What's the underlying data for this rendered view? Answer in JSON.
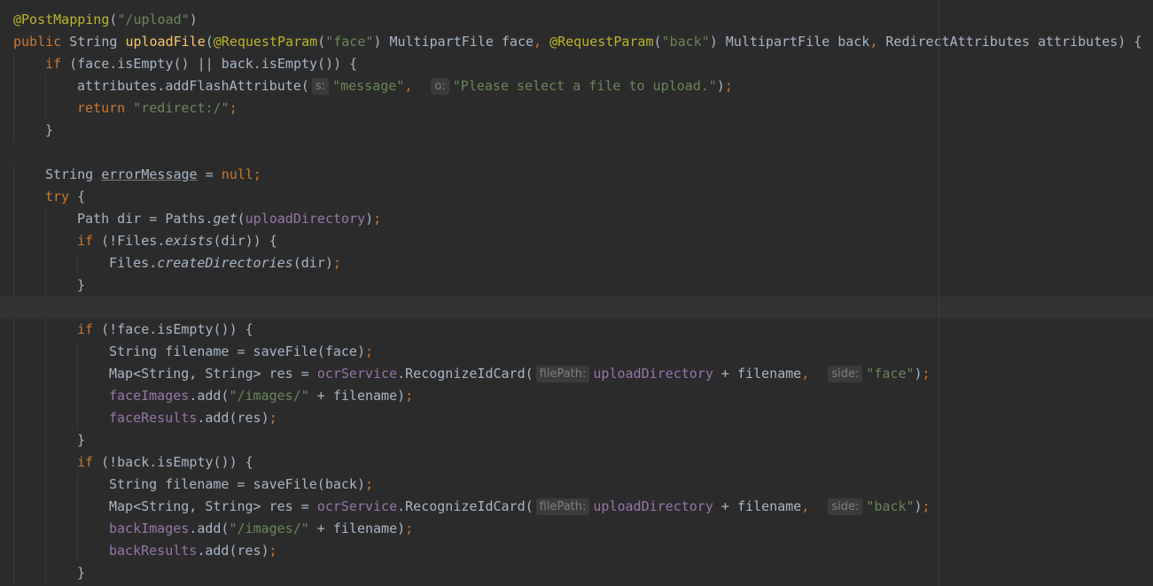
{
  "editor": {
    "language": "Java",
    "theme": "Darcula",
    "lines": [
      {
        "parts": [
          {
            "t": "@PostMapping",
            "c": "ann"
          },
          {
            "t": "(",
            "c": "p"
          },
          {
            "t": "\"/upload\"",
            "c": "str"
          },
          {
            "t": ")",
            "c": "p"
          }
        ]
      },
      {
        "parts": [
          {
            "t": "public ",
            "c": "kw"
          },
          {
            "t": "String ",
            "c": "p"
          },
          {
            "t": "uploadFile",
            "c": "fn"
          },
          {
            "t": "(",
            "c": "p"
          },
          {
            "t": "@RequestParam",
            "c": "ann"
          },
          {
            "t": "(",
            "c": "p"
          },
          {
            "t": "\"face\"",
            "c": "str"
          },
          {
            "t": ") MultipartFile face",
            "c": "p"
          },
          {
            "t": ", ",
            "c": "kw"
          },
          {
            "t": "@RequestParam",
            "c": "ann"
          },
          {
            "t": "(",
            "c": "p"
          },
          {
            "t": "\"back\"",
            "c": "str"
          },
          {
            "t": ") MultipartFile back",
            "c": "p"
          },
          {
            "t": ", ",
            "c": "kw"
          },
          {
            "t": "RedirectAttributes attributes) {",
            "c": "p"
          }
        ]
      },
      {
        "indent": 1,
        "parts": [
          {
            "t": "if ",
            "c": "kw"
          },
          {
            "t": "(face.isEmpty() || back.isEmpty()) {",
            "c": "p"
          }
        ]
      },
      {
        "indent": 2,
        "parts": [
          {
            "t": "attributes.addFlashAttribute(",
            "c": "p"
          },
          {
            "t": "s:",
            "c": "hint"
          },
          {
            "t": "\"message\"",
            "c": "str"
          },
          {
            "t": ",  ",
            "c": "kw"
          },
          {
            "t": "o:",
            "c": "hint"
          },
          {
            "t": "\"Please select a file to upload.\"",
            "c": "str"
          },
          {
            "t": ")",
            "c": "p"
          },
          {
            "t": ";",
            "c": "kw"
          }
        ]
      },
      {
        "indent": 2,
        "parts": [
          {
            "t": "return ",
            "c": "kw"
          },
          {
            "t": "\"redirect:/\"",
            "c": "str"
          },
          {
            "t": ";",
            "c": "kw"
          }
        ]
      },
      {
        "indent": 1,
        "parts": [
          {
            "t": "}",
            "c": "p"
          }
        ]
      },
      {
        "parts": []
      },
      {
        "indent": 1,
        "parts": [
          {
            "t": "String ",
            "c": "p"
          },
          {
            "t": "errorMessage",
            "c": "uline"
          },
          {
            "t": " = ",
            "c": "p"
          },
          {
            "t": "null;",
            "c": "kw"
          }
        ]
      },
      {
        "indent": 1,
        "parts": [
          {
            "t": "try ",
            "c": "kw"
          },
          {
            "t": "{",
            "c": "p"
          }
        ]
      },
      {
        "indent": 2,
        "parts": [
          {
            "t": "Path dir = Paths.",
            "c": "p"
          },
          {
            "t": "get",
            "c": "italic"
          },
          {
            "t": "(",
            "c": "p"
          },
          {
            "t": "uploadDirectory",
            "c": "field"
          },
          {
            "t": ")",
            "c": "p"
          },
          {
            "t": ";",
            "c": "kw"
          }
        ]
      },
      {
        "indent": 2,
        "parts": [
          {
            "t": "if ",
            "c": "kw"
          },
          {
            "t": "(!Files.",
            "c": "p"
          },
          {
            "t": "exists",
            "c": "italic"
          },
          {
            "t": "(dir)) {",
            "c": "p"
          }
        ]
      },
      {
        "indent": 3,
        "parts": [
          {
            "t": "Files.",
            "c": "p"
          },
          {
            "t": "createDirectories",
            "c": "italic"
          },
          {
            "t": "(dir)",
            "c": "p"
          },
          {
            "t": ";",
            "c": "kw"
          }
        ]
      },
      {
        "indent": 2,
        "parts": [
          {
            "t": "}",
            "c": "p"
          }
        ]
      },
      {
        "current": true,
        "parts": []
      },
      {
        "indent": 2,
        "parts": [
          {
            "t": "if ",
            "c": "kw"
          },
          {
            "t": "(!face.isEmpty()) {",
            "c": "p"
          }
        ]
      },
      {
        "indent": 3,
        "parts": [
          {
            "t": "String filename = saveFile(face)",
            "c": "p"
          },
          {
            "t": ";",
            "c": "kw"
          }
        ]
      },
      {
        "indent": 3,
        "parts": [
          {
            "t": "Map<String, String> res = ",
            "c": "p"
          },
          {
            "t": "ocrService",
            "c": "field"
          },
          {
            "t": ".RecognizeIdCard(",
            "c": "p"
          },
          {
            "t": "filePath:",
            "c": "hint"
          },
          {
            "t": "uploadDirectory",
            "c": "field"
          },
          {
            "t": " + filename",
            "c": "p"
          },
          {
            "t": ",  ",
            "c": "kw"
          },
          {
            "t": "side:",
            "c": "hint"
          },
          {
            "t": "\"face\"",
            "c": "str"
          },
          {
            "t": ")",
            "c": "p"
          },
          {
            "t": ";",
            "c": "kw"
          }
        ]
      },
      {
        "indent": 3,
        "parts": [
          {
            "t": "faceImages",
            "c": "field"
          },
          {
            "t": ".add(",
            "c": "p"
          },
          {
            "t": "\"/images/\"",
            "c": "str"
          },
          {
            "t": " + filename)",
            "c": "p"
          },
          {
            "t": ";",
            "c": "kw"
          }
        ]
      },
      {
        "indent": 3,
        "parts": [
          {
            "t": "faceResults",
            "c": "field"
          },
          {
            "t": ".add(res)",
            "c": "p"
          },
          {
            "t": ";",
            "c": "kw"
          }
        ]
      },
      {
        "indent": 2,
        "parts": [
          {
            "t": "}",
            "c": "p"
          }
        ]
      },
      {
        "indent": 2,
        "parts": [
          {
            "t": "if ",
            "c": "kw"
          },
          {
            "t": "(!back.isEmpty()) {",
            "c": "p"
          }
        ]
      },
      {
        "indent": 3,
        "parts": [
          {
            "t": "String filename = saveFile(back)",
            "c": "p"
          },
          {
            "t": ";",
            "c": "kw"
          }
        ]
      },
      {
        "indent": 3,
        "parts": [
          {
            "t": "Map<String, String> res = ",
            "c": "p"
          },
          {
            "t": "ocrService",
            "c": "field"
          },
          {
            "t": ".RecognizeIdCard(",
            "c": "p"
          },
          {
            "t": "filePath:",
            "c": "hint"
          },
          {
            "t": "uploadDirectory",
            "c": "field"
          },
          {
            "t": " + filename",
            "c": "p"
          },
          {
            "t": ",  ",
            "c": "kw"
          },
          {
            "t": "side:",
            "c": "hint"
          },
          {
            "t": "\"back\"",
            "c": "str"
          },
          {
            "t": ")",
            "c": "p"
          },
          {
            "t": ";",
            "c": "kw"
          }
        ]
      },
      {
        "indent": 3,
        "parts": [
          {
            "t": "backImages",
            "c": "field"
          },
          {
            "t": ".add(",
            "c": "p"
          },
          {
            "t": "\"/images/\"",
            "c": "str"
          },
          {
            "t": " + filename)",
            "c": "p"
          },
          {
            "t": ";",
            "c": "kw"
          }
        ]
      },
      {
        "indent": 3,
        "parts": [
          {
            "t": "backResults",
            "c": "field"
          },
          {
            "t": ".add(res)",
            "c": "p"
          },
          {
            "t": ";",
            "c": "kw"
          }
        ]
      },
      {
        "indent": 2,
        "parts": [
          {
            "t": "}",
            "c": "p"
          }
        ]
      }
    ]
  },
  "colors": {
    "background": "#2b2b2b",
    "current_line": "#323232",
    "plain": "#a9b7c6",
    "keyword": "#cc7832",
    "annotation": "#bbb529",
    "string": "#6a8759",
    "field": "#9876aa",
    "method_decl": "#ffc66d",
    "hint_text": "#808080"
  }
}
